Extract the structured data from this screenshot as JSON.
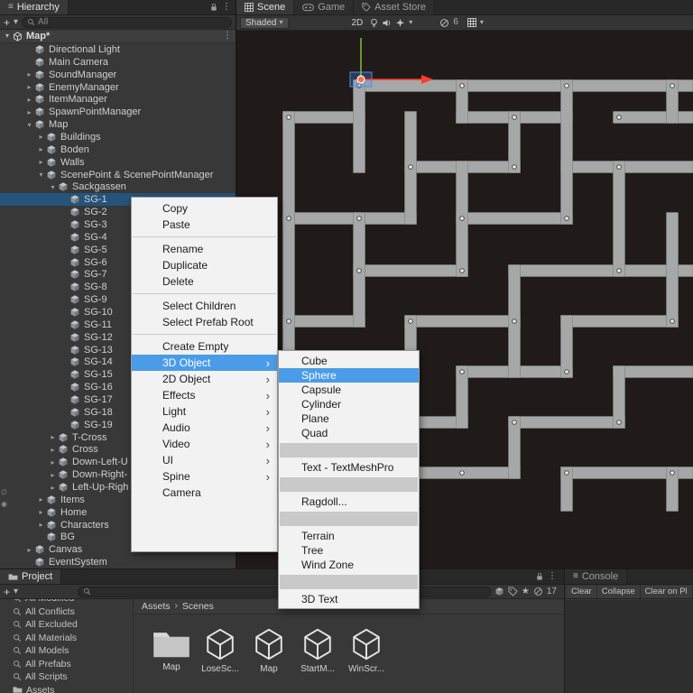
{
  "icons": {
    "hamburger": "≡",
    "kebab": "⋮",
    "caret_down": "▾",
    "plus": "+",
    "breadcrumb_sep": "›",
    "star": "★",
    "slash_circle": "∅",
    "vis_toggle_a": "∅",
    "vis_toggle_b": "◉"
  },
  "colors": {
    "selection_blue": "#24537b",
    "menu_highlight": "#4a9ce8",
    "scene_bg": "#201b18",
    "corridor_gray": "#a6a8a7",
    "gizmo_red": "#ff3b30",
    "gizmo_green": "#7ac143",
    "gizmo_orange": "#ff7043"
  },
  "hierarchy": {
    "tab": "Hierarchy",
    "search_text": "All",
    "scene_row": {
      "label": "Map*",
      "arrow": "▾"
    },
    "items": [
      {
        "label": "Directional Light",
        "depth": 1,
        "arrow": ""
      },
      {
        "label": "Main Camera",
        "depth": 1,
        "arrow": ""
      },
      {
        "label": "SoundManager",
        "depth": 1,
        "arrow": "▸"
      },
      {
        "label": "EnemyManager",
        "depth": 1,
        "arrow": "▸"
      },
      {
        "label": "ItemManager",
        "depth": 1,
        "arrow": "▸"
      },
      {
        "label": "SpawnPointManager",
        "depth": 1,
        "arrow": "▸"
      },
      {
        "label": "Map",
        "depth": 1,
        "arrow": "▾"
      },
      {
        "label": "Buildings",
        "depth": 2,
        "arrow": "▸"
      },
      {
        "label": "Boden",
        "depth": 2,
        "arrow": "▸"
      },
      {
        "label": "Walls",
        "depth": 2,
        "arrow": "▸"
      },
      {
        "label": "ScenePoint & ScenePointManager",
        "depth": 2,
        "arrow": "▾"
      },
      {
        "label": "Sackgassen",
        "depth": 3,
        "arrow": "▾"
      },
      {
        "label": "SG-1",
        "depth": 4,
        "arrow": "",
        "cls": "selected"
      },
      {
        "label": "SG-2",
        "depth": 4,
        "arrow": ""
      },
      {
        "label": "SG-3",
        "depth": 4,
        "arrow": ""
      },
      {
        "label": "SG-4",
        "depth": 4,
        "arrow": ""
      },
      {
        "label": "SG-5",
        "depth": 4,
        "arrow": ""
      },
      {
        "label": "SG-6",
        "depth": 4,
        "arrow": ""
      },
      {
        "label": "SG-7",
        "depth": 4,
        "arrow": ""
      },
      {
        "label": "SG-8",
        "depth": 4,
        "arrow": ""
      },
      {
        "label": "SG-9",
        "depth": 4,
        "arrow": ""
      },
      {
        "label": "SG-10",
        "depth": 4,
        "arrow": ""
      },
      {
        "label": "SG-11",
        "depth": 4,
        "arrow": ""
      },
      {
        "label": "SG-12",
        "depth": 4,
        "arrow": ""
      },
      {
        "label": "SG-13",
        "depth": 4,
        "arrow": ""
      },
      {
        "label": "SG-14",
        "depth": 4,
        "arrow": ""
      },
      {
        "label": "SG-15",
        "depth": 4,
        "arrow": ""
      },
      {
        "label": "SG-16",
        "depth": 4,
        "arrow": ""
      },
      {
        "label": "SG-17",
        "depth": 4,
        "arrow": ""
      },
      {
        "label": "SG-18",
        "depth": 4,
        "arrow": ""
      },
      {
        "label": "SG-19",
        "depth": 4,
        "arrow": ""
      },
      {
        "label": "T-Cross",
        "depth": 3,
        "arrow": "▸"
      },
      {
        "label": "Cross",
        "depth": 3,
        "arrow": "▸"
      },
      {
        "label": "Down-Left-U",
        "depth": 3,
        "arrow": "▸"
      },
      {
        "label": "Down-Right-",
        "depth": 3,
        "arrow": "▸"
      },
      {
        "label": "Left-Up-Righ",
        "depth": 3,
        "arrow": "▸"
      },
      {
        "label": "Items",
        "depth": 2,
        "arrow": "▸"
      },
      {
        "label": "Home",
        "depth": 2,
        "arrow": "▸"
      },
      {
        "label": "Characters",
        "depth": 2,
        "arrow": "▸"
      },
      {
        "label": "BG",
        "depth": 2,
        "arrow": ""
      },
      {
        "label": "Canvas",
        "depth": 1,
        "arrow": "▸"
      },
      {
        "label": "EventSystem",
        "depth": 1,
        "arrow": ""
      }
    ]
  },
  "context_menu": {
    "items": [
      {
        "label": "Copy"
      },
      {
        "label": "Paste"
      },
      {
        "sep": true
      },
      {
        "label": "Rename"
      },
      {
        "label": "Duplicate"
      },
      {
        "label": "Delete"
      },
      {
        "sep": true
      },
      {
        "label": "Select Children"
      },
      {
        "label": "Select Prefab Root"
      },
      {
        "sep": true
      },
      {
        "label": "Create Empty"
      },
      {
        "label": "3D Object",
        "arrow": "›",
        "cls": "highlight"
      },
      {
        "label": "2D Object",
        "arrow": "›"
      },
      {
        "label": "Effects",
        "arrow": "›"
      },
      {
        "label": "Light",
        "arrow": "›"
      },
      {
        "label": "Audio",
        "arrow": "›"
      },
      {
        "label": "Video",
        "arrow": "›"
      },
      {
        "label": "UI",
        "arrow": "›"
      },
      {
        "label": "Spine",
        "arrow": "›"
      },
      {
        "label": "Camera"
      }
    ]
  },
  "submenu": {
    "items": [
      {
        "label": "Cube"
      },
      {
        "label": "Sphere",
        "cls": "highlight"
      },
      {
        "label": "Capsule"
      },
      {
        "label": "Cylinder"
      },
      {
        "label": "Plane"
      },
      {
        "label": "Quad"
      },
      {
        "sep": true
      },
      {
        "label": "Text - TextMeshPro"
      },
      {
        "sep": true
      },
      {
        "label": "Ragdoll..."
      },
      {
        "sep": true
      },
      {
        "label": "Terrain"
      },
      {
        "label": "Tree"
      },
      {
        "label": "Wind Zone"
      },
      {
        "sep": true
      },
      {
        "label": "3D Text"
      }
    ]
  },
  "scene_view": {
    "tabs": [
      {
        "label": "Scene",
        "icon": "grid",
        "cls": "active"
      },
      {
        "label": "Game",
        "icon": "game"
      },
      {
        "label": "Asset Store",
        "icon": "store"
      }
    ],
    "shading": "Shaded",
    "mode_2d": "2D",
    "hidden_count": "6"
  },
  "project": {
    "tab": "Project",
    "hidden_count": "17",
    "favorites": [
      {
        "label": "All Modified",
        "type": "search"
      },
      {
        "label": "All Conflicts",
        "type": "search"
      },
      {
        "label": "All Excluded",
        "type": "search"
      },
      {
        "label": "All Materials",
        "type": "search"
      },
      {
        "label": "All Models",
        "type": "search"
      },
      {
        "label": "All Prefabs",
        "type": "search"
      },
      {
        "label": "All Scripts",
        "type": "search"
      },
      {
        "label": "Assets",
        "type": "folder"
      }
    ],
    "breadcrumb": {
      "root": "Assets",
      "current": "Scenes"
    },
    "assets": [
      {
        "label": "Map",
        "type": "folder"
      },
      {
        "label": "LoseSc...",
        "type": "scene"
      },
      {
        "label": "Map",
        "type": "scene"
      },
      {
        "label": "StartM...",
        "type": "scene"
      },
      {
        "label": "WinScr...",
        "type": "scene"
      }
    ]
  },
  "console": {
    "tab": "Console",
    "buttons": [
      {
        "label": "Clear"
      },
      {
        "label": "Collapse"
      },
      {
        "label": "Clear on Pl"
      }
    ]
  }
}
